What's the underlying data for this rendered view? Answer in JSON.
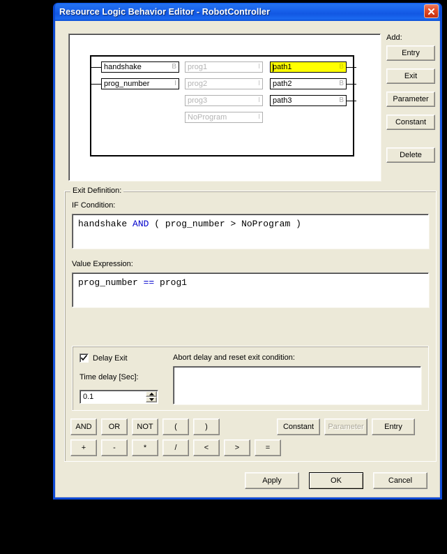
{
  "window": {
    "title": "Resource Logic Behavior Editor - RobotController",
    "close_icon": "close-icon"
  },
  "diagram": {
    "entries": [
      {
        "name": "handshake",
        "type": "B",
        "state": "normal"
      },
      {
        "name": "prog_number",
        "type": "I",
        "state": "normal"
      }
    ],
    "middle": [
      {
        "name": "prog1",
        "type": "I",
        "state": "dim"
      },
      {
        "name": "prog2",
        "type": "I",
        "state": "dim"
      },
      {
        "name": "prog3",
        "type": "I",
        "state": "dim"
      },
      {
        "name": "NoProgram",
        "type": "I",
        "state": "dim"
      }
    ],
    "exits": [
      {
        "name": "path1",
        "type": "B",
        "state": "selected"
      },
      {
        "name": "path2",
        "type": "B",
        "state": "normal"
      },
      {
        "name": "path3",
        "type": "B",
        "state": "normal"
      }
    ]
  },
  "sidebar": {
    "add_label": "Add:",
    "buttons": [
      {
        "label": "Entry"
      },
      {
        "label": "Exit"
      },
      {
        "label": "Parameter"
      },
      {
        "label": "Constant"
      }
    ],
    "delete_label": "Delete"
  },
  "exit_definition": {
    "legend": "Exit Definition:",
    "if_condition_label": "IF Condition:",
    "if_condition": {
      "parts": [
        {
          "text": "handshake ",
          "kind": "plain"
        },
        {
          "text": "AND",
          "kind": "operator"
        },
        {
          "text": " ( prog_number ",
          "kind": "plain"
        },
        {
          "text": ">",
          "kind": "plain"
        },
        {
          "text": " NoProgram )",
          "kind": "plain"
        }
      ],
      "text": "handshake AND ( prog_number > NoProgram )"
    },
    "value_expression_label": "Value Expression:",
    "value_expression": {
      "parts": [
        {
          "text": "prog_number ",
          "kind": "plain"
        },
        {
          "text": "==",
          "kind": "operator"
        },
        {
          "text": " prog1",
          "kind": "plain"
        }
      ],
      "text": "prog_number == prog1"
    },
    "delay": {
      "checkbox_label": "Delay Exit",
      "checked": true,
      "time_label": "Time delay [Sec]:",
      "time_value": "0.1",
      "abort_label": "Abort delay and reset exit condition:",
      "abort_value": ""
    },
    "keypad": {
      "row1": [
        "AND",
        "OR",
        "NOT",
        "(",
        ")"
      ],
      "row2": [
        "+",
        "-",
        "*",
        "/",
        "<",
        ">",
        "="
      ],
      "right": [
        {
          "label": "Constant",
          "disabled": false
        },
        {
          "label": "Parameter",
          "disabled": true
        },
        {
          "label": "Entry",
          "disabled": false
        }
      ]
    }
  },
  "footer": {
    "apply": "Apply",
    "ok": "OK",
    "cancel": "Cancel"
  },
  "colors": {
    "title_blue": "#1a63ec",
    "dialog_face": "#ece9d8",
    "selection_yellow": "#ffff00",
    "operator_blue": "#0000cc",
    "close_red": "#e24a24"
  }
}
